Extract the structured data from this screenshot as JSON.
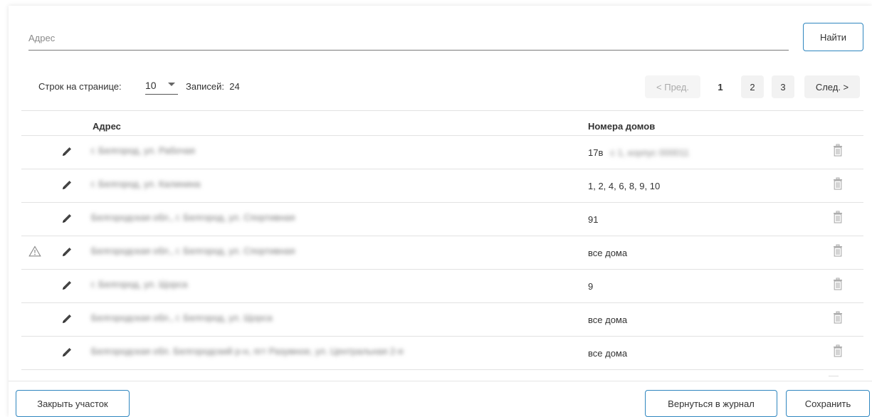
{
  "search": {
    "placeholder": "Адрес",
    "button_label": "Найти"
  },
  "pagination": {
    "rows_per_page_label": "Строк на странице:",
    "rows_per_page_value": "10",
    "records_label": "Записей:",
    "records_count": "24",
    "prev_label": "< Пред.",
    "pages": [
      "1",
      "2",
      "3"
    ],
    "current_page": "1",
    "next_label": "След. >"
  },
  "table": {
    "columns": {
      "address": "Адрес",
      "houses": "Номера домов"
    },
    "rows": [
      {
        "address": "г. Белгород, ул. Рабочая",
        "houses": "17в",
        "houses_extra": "с 1, корпус 000011",
        "warning": false
      },
      {
        "address": "г. Белгород, ул. Калинина",
        "houses": "1, 2, 4, 6, 8, 9, 10",
        "warning": false
      },
      {
        "address": "Белгородская обл., г. Белгород, ул. Спортивная",
        "houses": "91",
        "warning": false
      },
      {
        "address": "Белгородская обл., г. Белгород, ул. Спортивная",
        "houses": "все дома",
        "warning": true
      },
      {
        "address": "г. Белгород, ул. Щорса",
        "houses": "9",
        "warning": false
      },
      {
        "address": "Белгородская обл., г. Белгород, ул. Щорса",
        "houses": "все дома",
        "warning": false
      },
      {
        "address": "Белгородская обл. Белгородский р-н, пгт Разумное, ул. Центральная 2-я",
        "houses": "все дома",
        "warning": false
      }
    ]
  },
  "footer": {
    "close_label": "Закрыть участок",
    "back_label": "Вернуться в журнал",
    "save_label": "Сохранить"
  },
  "colors": {
    "accent_border": "#2f86bf",
    "divider": "#e2e2e2"
  }
}
